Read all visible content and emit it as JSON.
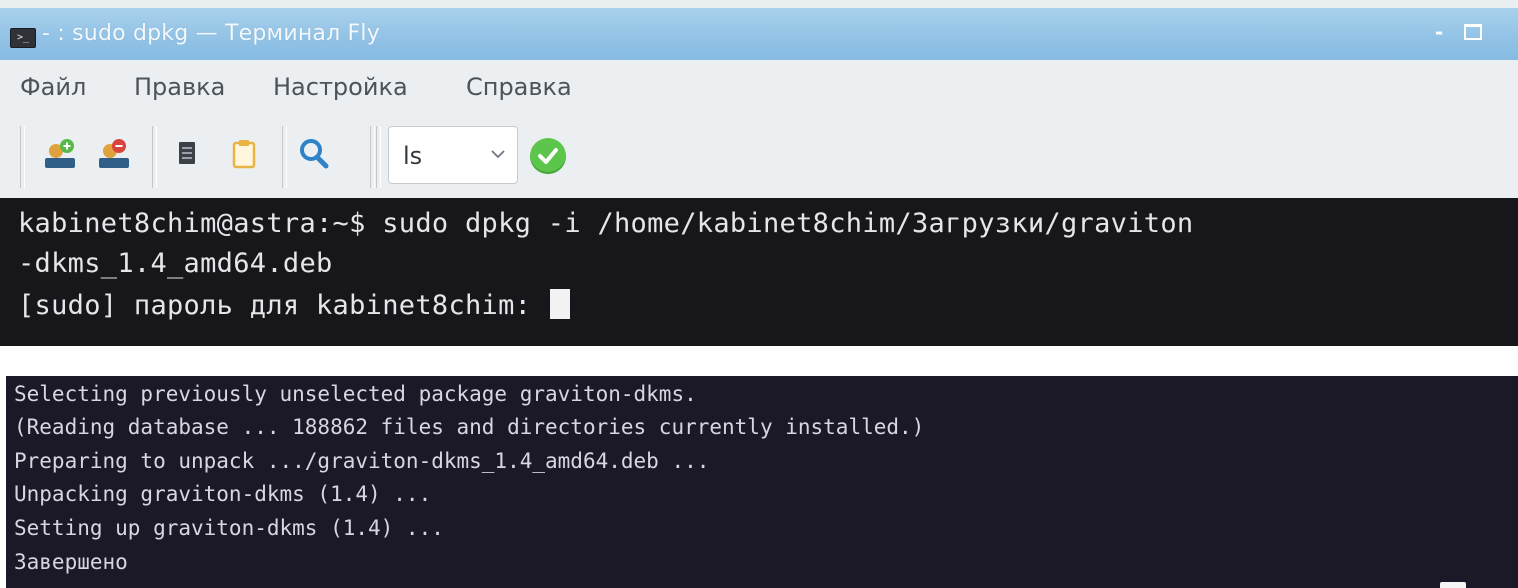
{
  "window": {
    "title": "- : sudo dpkg — Терминал Fly",
    "icon": "terminal-icon",
    "minimize_glyph": "-",
    "title_bar_color": "#93c3e6"
  },
  "menu": {
    "items": [
      "Файл",
      "Правка",
      "Настройка",
      "Справка"
    ]
  },
  "toolbar": {
    "buttons": [
      "new-session-icon",
      "close-session-icon",
      "copy-icon",
      "paste-icon",
      "search-icon"
    ],
    "command_combo": {
      "value": "ls"
    },
    "run_button": "ok-check-icon"
  },
  "terminal_top": {
    "background": "#17161b",
    "lines": [
      "kabinet8chim@astra:~$ sudo dpkg -i /home/kabinet8chim/Загрузки/graviton",
      "-dkms_1.4_amd64.deb",
      "[sudo] пароль для kabinet8chim: "
    ]
  },
  "terminal_bottom": {
    "background": "#1b1928",
    "lines": [
      "Selecting previously unselected package graviton-dkms.",
      "(Reading database ... 188862 files and directories currently installed.)",
      "Preparing to unpack .../graviton-dkms_1.4_amd64.deb ...",
      "Unpacking graviton-dkms (1.4) ...",
      "Setting up graviton-dkms (1.4) ...",
      "Завершено"
    ]
  }
}
